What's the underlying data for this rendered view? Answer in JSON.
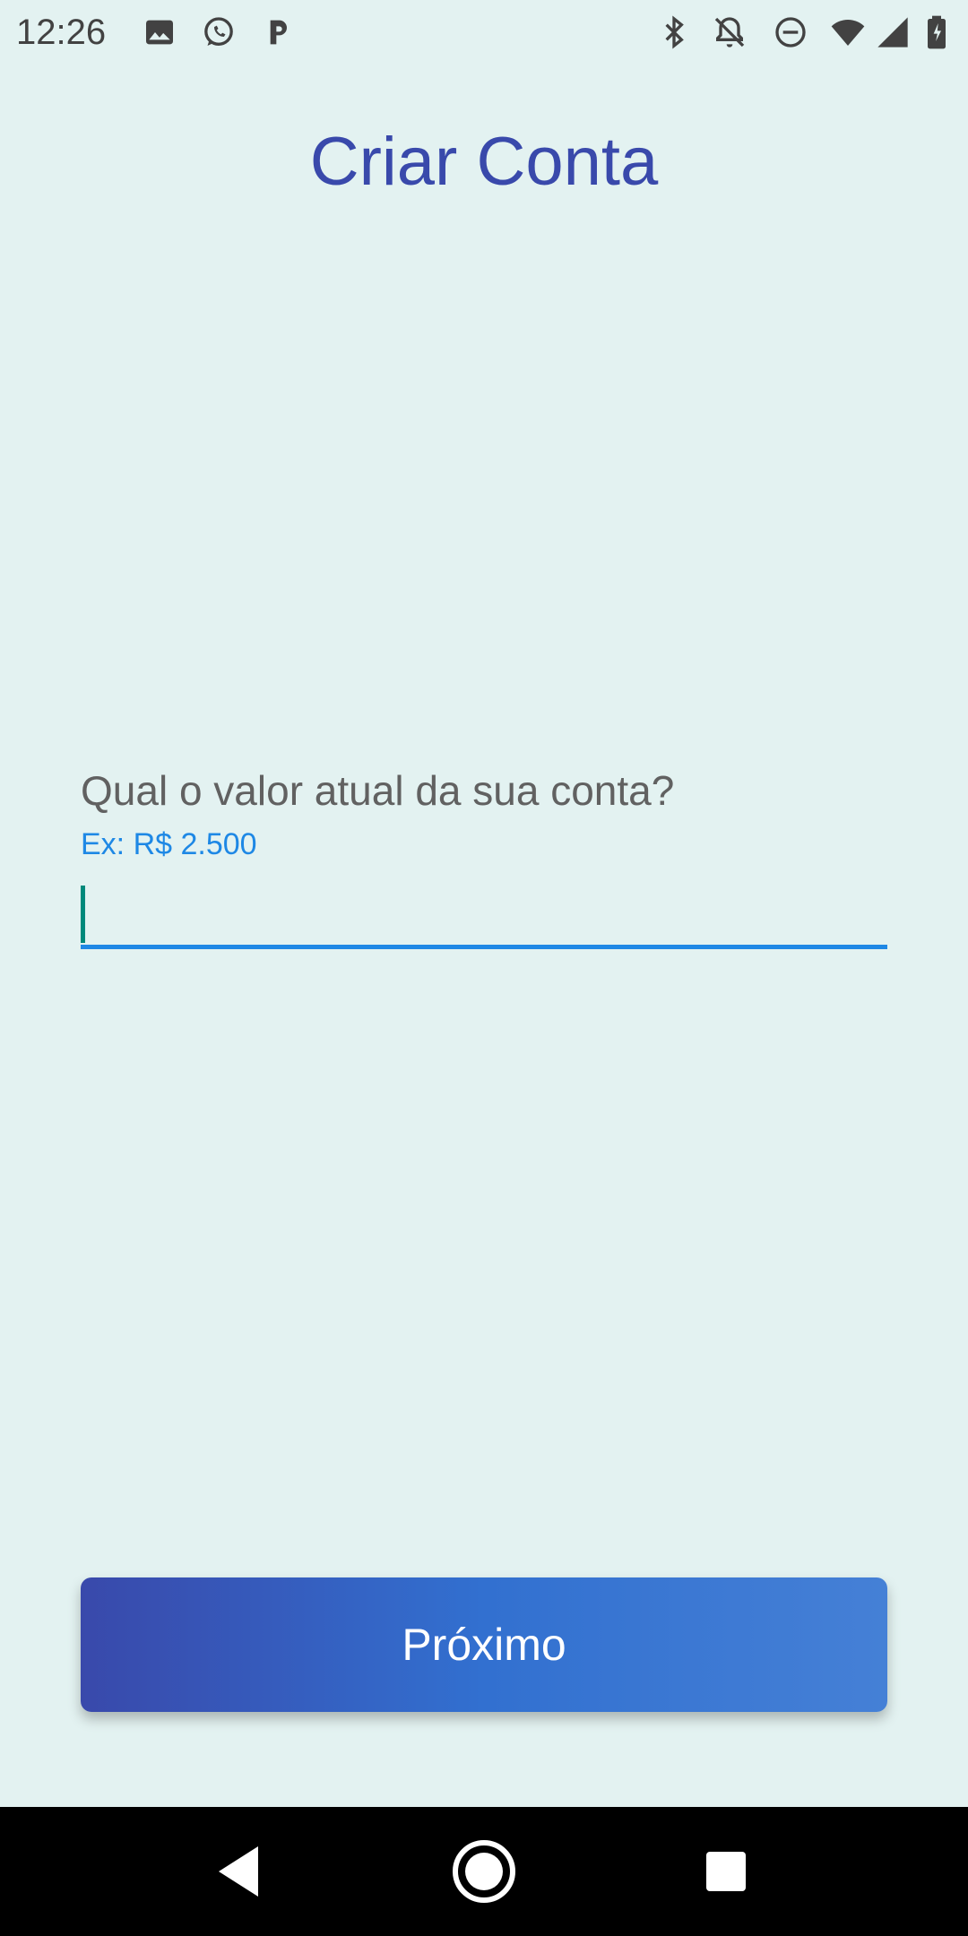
{
  "status_bar": {
    "time": "12:26",
    "left_icons": [
      "image-icon",
      "whatsapp-icon",
      "parking-icon"
    ],
    "right_icons": [
      "bluetooth-icon",
      "notifications-off-icon",
      "do-not-disturb-icon",
      "wifi-icon",
      "signal-icon",
      "battery-charging-icon"
    ]
  },
  "screen": {
    "title": "Criar Conta"
  },
  "form": {
    "question": "Qual o valor atual da sua conta?",
    "hint": "Ex: R$ 2.500",
    "value": ""
  },
  "actions": {
    "next_label": "Próximo"
  },
  "nav_bar": {
    "buttons": [
      "back-icon",
      "home-icon",
      "recents-icon"
    ]
  },
  "colors": {
    "background": "#e3f2f1",
    "title": "#3949ab",
    "accent": "#1e88e5",
    "caret": "#00897b",
    "button_start": "#3949ab",
    "button_end": "#4580d6"
  }
}
